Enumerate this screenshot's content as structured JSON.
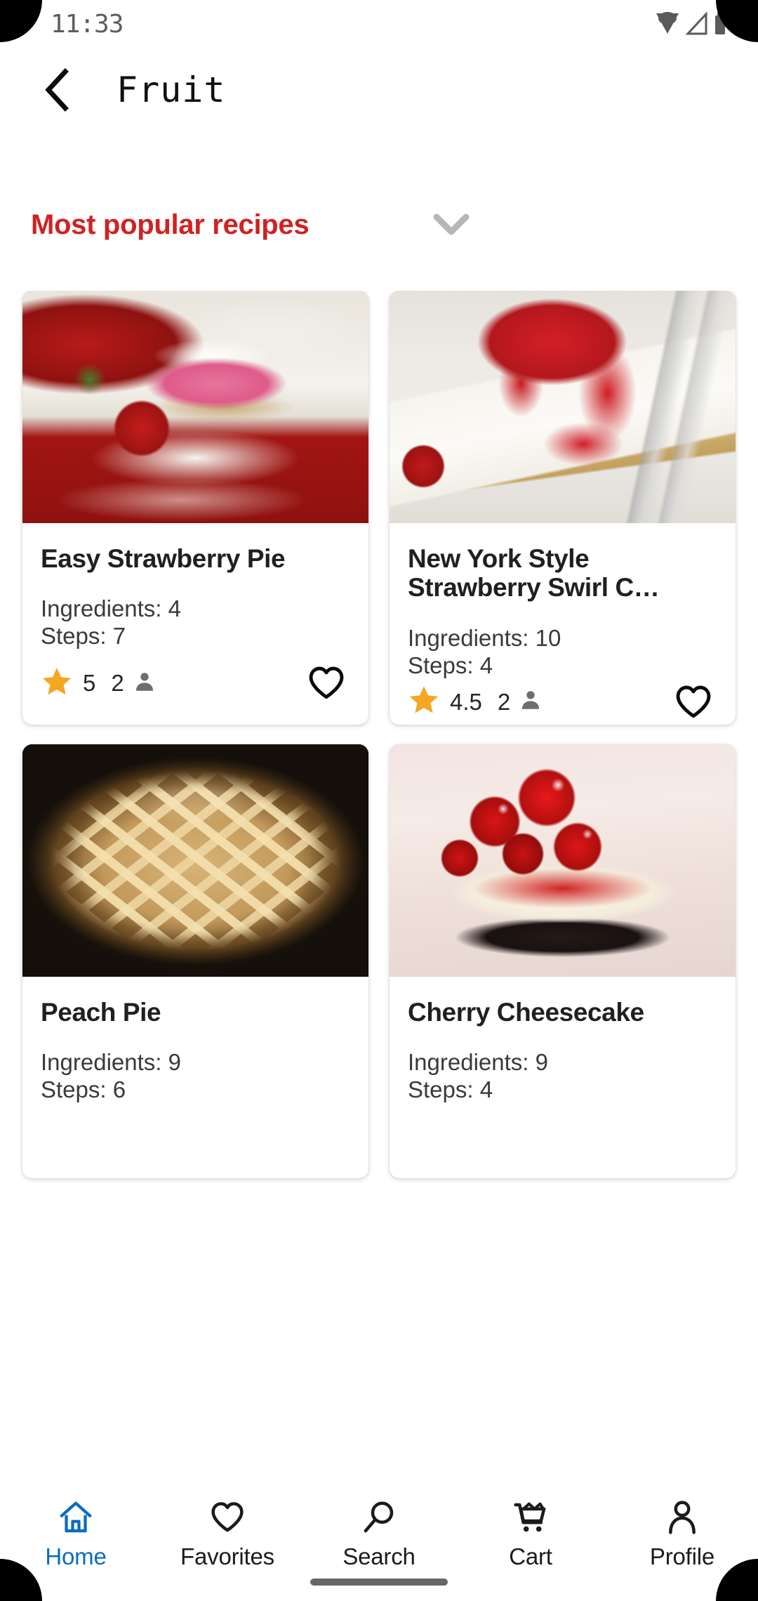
{
  "status_bar": {
    "time": "11:33",
    "icons": [
      "wifi-icon",
      "cellular-signal-icon",
      "battery-icon"
    ]
  },
  "app_bar": {
    "back_icon": "back-chevron-icon",
    "title": "Fruit"
  },
  "sort_header": {
    "label": "Most popular recipes",
    "color": "#d02222",
    "chevron_icon": "chevron-down-icon"
  },
  "recipes": [
    {
      "title": "Easy Strawberry Pie",
      "ingredients_label": "Ingredients: 4",
      "steps_label": "Steps: 7",
      "rating": "5",
      "rating_count": "2",
      "star_icon": "star-icon",
      "person_icon": "person-icon",
      "favorite_icon": "heart-outline-icon",
      "favorited": false,
      "photo": "photo-strawberry-pie"
    },
    {
      "title": "New York Style Strawberry Swirl C…",
      "ingredients_label": "Ingredients: 10",
      "steps_label": "Steps: 4",
      "rating": "4.5",
      "rating_count": "2",
      "star_icon": "star-icon",
      "person_icon": "person-icon",
      "favorite_icon": "heart-outline-icon",
      "favorited": false,
      "photo": "photo-ny-cheesecake"
    },
    {
      "title": "Peach Pie",
      "ingredients_label": "Ingredients: 9",
      "steps_label": "Steps: 6",
      "rating": "",
      "rating_count": "",
      "star_icon": "star-icon",
      "person_icon": "person-icon",
      "favorite_icon": "heart-outline-icon",
      "favorited": false,
      "photo": "photo-peach-pie"
    },
    {
      "title": "Cherry Cheesecake",
      "ingredients_label": "Ingredients: 9",
      "steps_label": "Steps: 4",
      "rating": "",
      "rating_count": "",
      "star_icon": "star-icon",
      "person_icon": "person-icon",
      "favorite_icon": "heart-outline-icon",
      "favorited": false,
      "photo": "photo-cherry-cheesecake"
    }
  ],
  "bottom_nav": {
    "active_color": "#0a6cc2",
    "items": [
      {
        "label": "Home",
        "icon": "home-icon",
        "active": true
      },
      {
        "label": "Favorites",
        "icon": "heart-outline-icon",
        "active": false
      },
      {
        "label": "Search",
        "icon": "search-icon",
        "active": false
      },
      {
        "label": "Cart",
        "icon": "shopping-cart-icon",
        "active": false
      },
      {
        "label": "Profile",
        "icon": "person-icon",
        "active": false
      }
    ]
  },
  "colors": {
    "star": "#f5a623",
    "accent_red": "#d02222",
    "nav_active": "#0a6cc2",
    "card_bg": "#ffffff",
    "page_bg": "#ffffff"
  }
}
